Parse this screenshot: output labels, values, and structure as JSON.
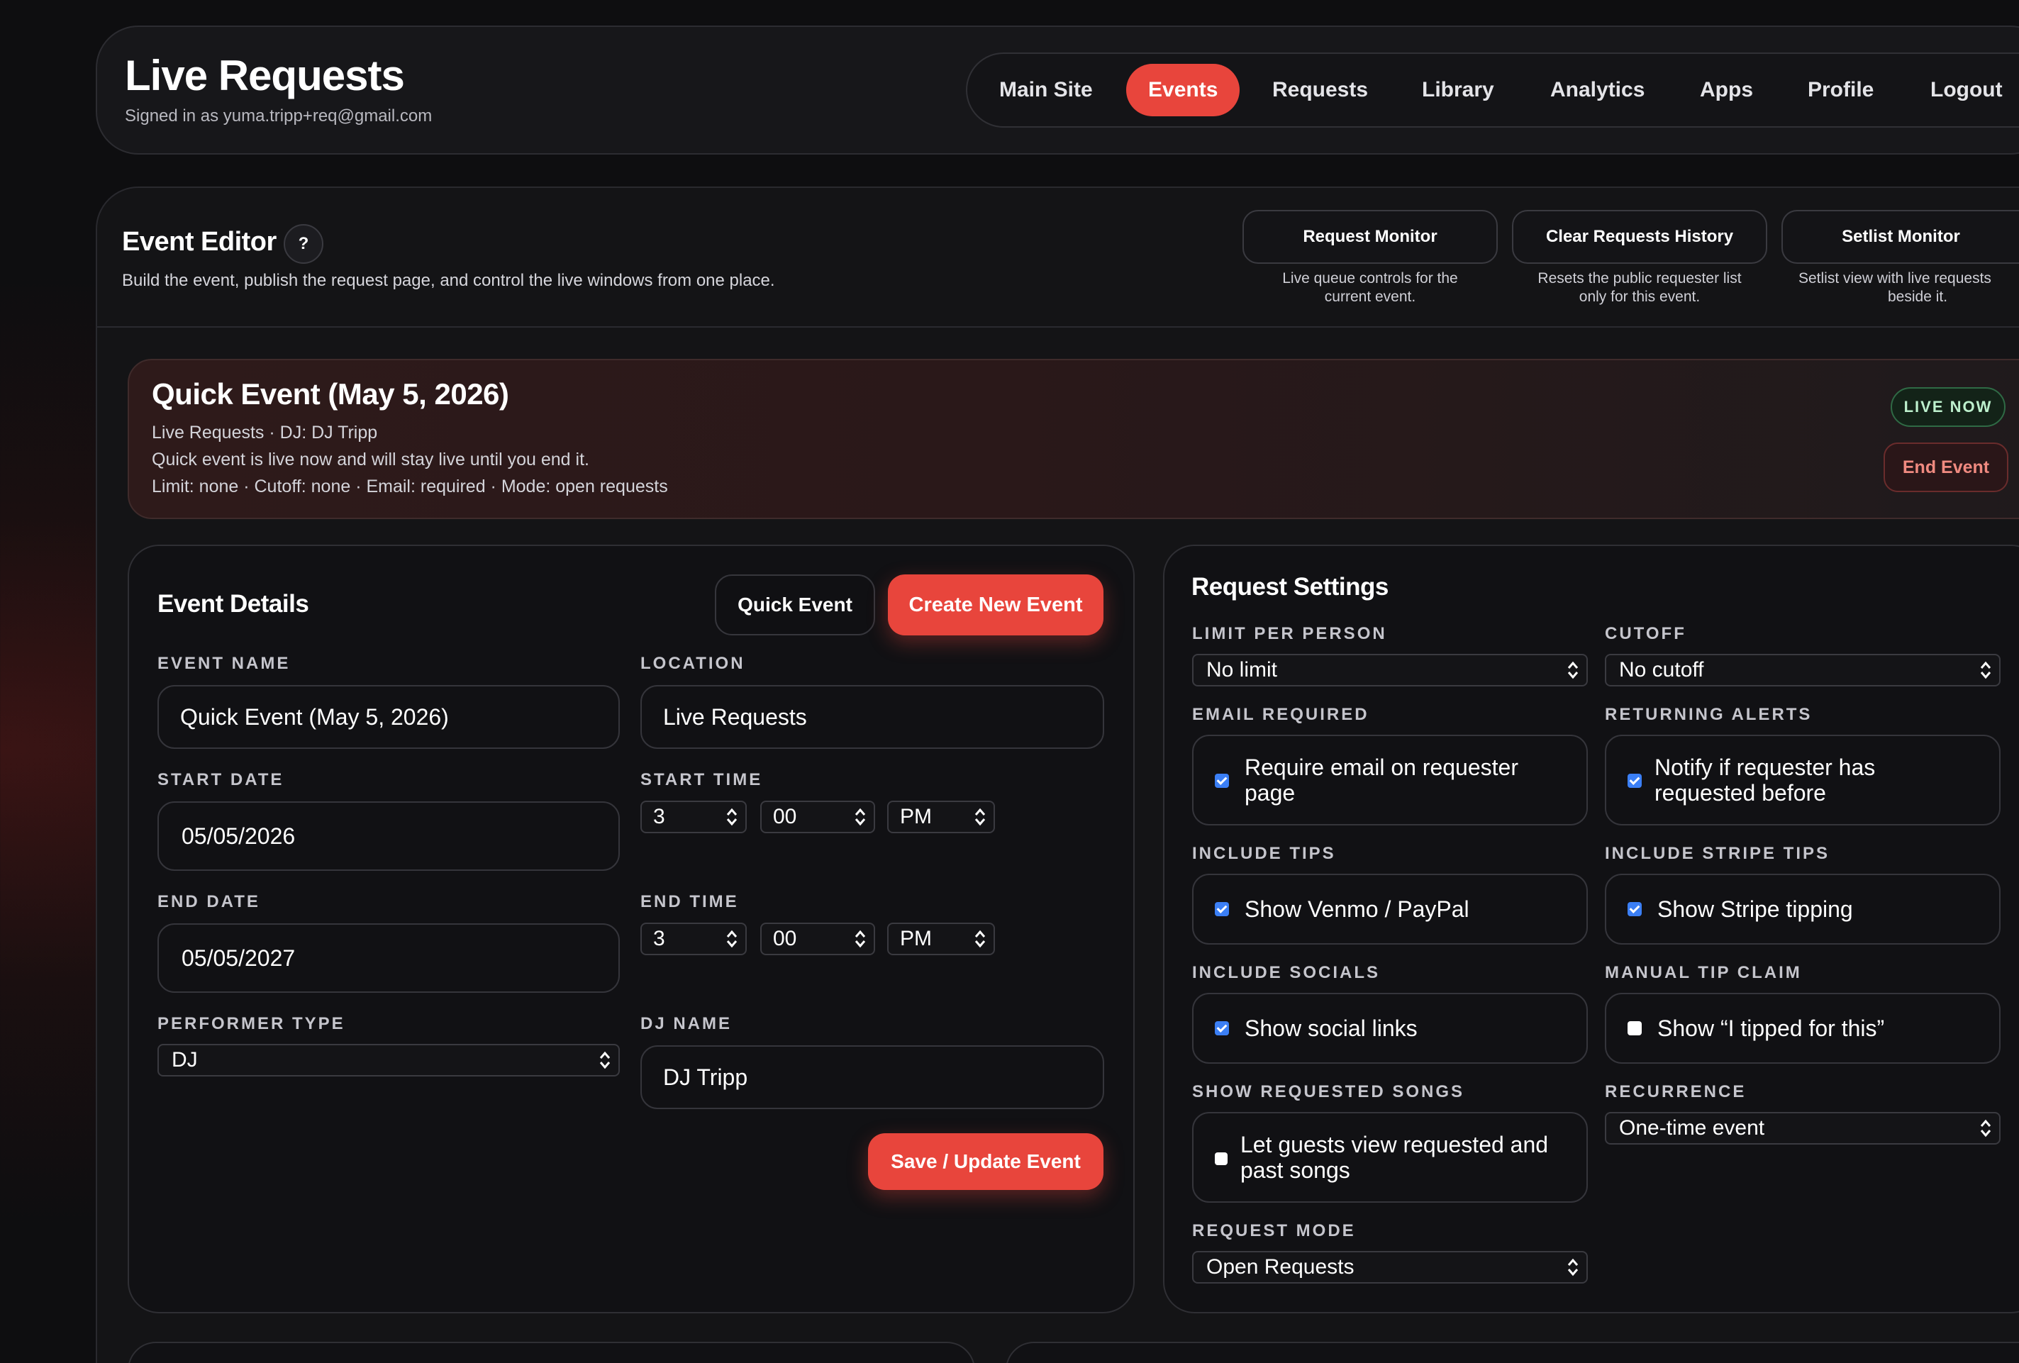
{
  "header": {
    "title": "Live Requests",
    "signed_in": "Signed in as yuma.tripp+req@gmail.com",
    "nav": [
      "Main Site",
      "Events",
      "Requests",
      "Library",
      "Analytics",
      "Apps",
      "Profile",
      "Logout"
    ],
    "active_nav": "Events"
  },
  "editor": {
    "title": "Event Editor",
    "help": "?",
    "subtitle": "Build the event, publish the request page, and control the live windows from one place.",
    "actions": [
      {
        "label": "Request Monitor",
        "desc1": "Live queue controls for the",
        "desc2": "current event."
      },
      {
        "label": "Clear Requests History",
        "desc1": "Resets the public requester list",
        "desc2": "only for this event."
      },
      {
        "label": "Setlist Monitor",
        "desc1": "Setlist view with live requests",
        "desc2": "beside it."
      }
    ]
  },
  "banner": {
    "title": "Quick Event (May 5, 2026)",
    "line1": "Live Requests · DJ: DJ Tripp",
    "line2": "Quick event is live now and will stay live until you end it.",
    "line3": "Limit: none · Cutoff: none · Email: required · Mode: open requests",
    "live_badge": "LIVE NOW",
    "end_button": "End Event"
  },
  "details": {
    "title": "Event Details",
    "quick_event": "Quick Event",
    "create_new": "Create New Event",
    "event_name_label": "EVENT NAME",
    "event_name": "Quick Event (May 5, 2026)",
    "location_label": "LOCATION",
    "location": "Live Requests",
    "start_date_label": "START DATE",
    "start_date": "05/05/2026",
    "start_time_label": "START TIME",
    "start_hour": "3",
    "start_minute": "00",
    "start_ampm": "PM",
    "end_date_label": "END DATE",
    "end_date": "05/05/2027",
    "end_time_label": "END TIME",
    "end_hour": "3",
    "end_minute": "00",
    "end_ampm": "PM",
    "performer_type_label": "PERFORMER TYPE",
    "performer_type": "DJ",
    "dj_name_label": "DJ NAME",
    "dj_name": "DJ Tripp",
    "save": "Save / Update Event"
  },
  "settings": {
    "title": "Request Settings",
    "limit_label": "LIMIT PER PERSON",
    "limit": "No limit",
    "cutoff_label": "CUTOFF",
    "cutoff": "No cutoff",
    "email_label": "EMAIL REQUIRED",
    "email_text": "Require email on requester page",
    "email_checked": true,
    "returning_label": "RETURNING ALERTS",
    "returning_text": "Notify if requester has requested before",
    "returning_checked": true,
    "tips_label": "INCLUDE TIPS",
    "tips_text": "Show Venmo / PayPal",
    "tips_checked": true,
    "stripe_label": "INCLUDE STRIPE TIPS",
    "stripe_text": "Show Stripe tipping",
    "stripe_checked": true,
    "socials_label": "INCLUDE SOCIALS",
    "socials_text": "Show social links",
    "socials_checked": true,
    "manual_label": "MANUAL TIP CLAIM",
    "manual_text": "Show “I tipped for this”",
    "manual_checked": false,
    "show_songs_label": "SHOW REQUESTED SONGS",
    "show_songs_text": "Let guests view requested and past songs",
    "show_songs_checked": false,
    "recurrence_label": "RECURRENCE",
    "recurrence": "One-time event",
    "mode_label": "REQUEST MODE",
    "mode": "Open Requests"
  },
  "colors": {
    "accent": "#e8453c",
    "live_green": "#2f6a45",
    "checkbox_blue": "#3b7ff5"
  }
}
